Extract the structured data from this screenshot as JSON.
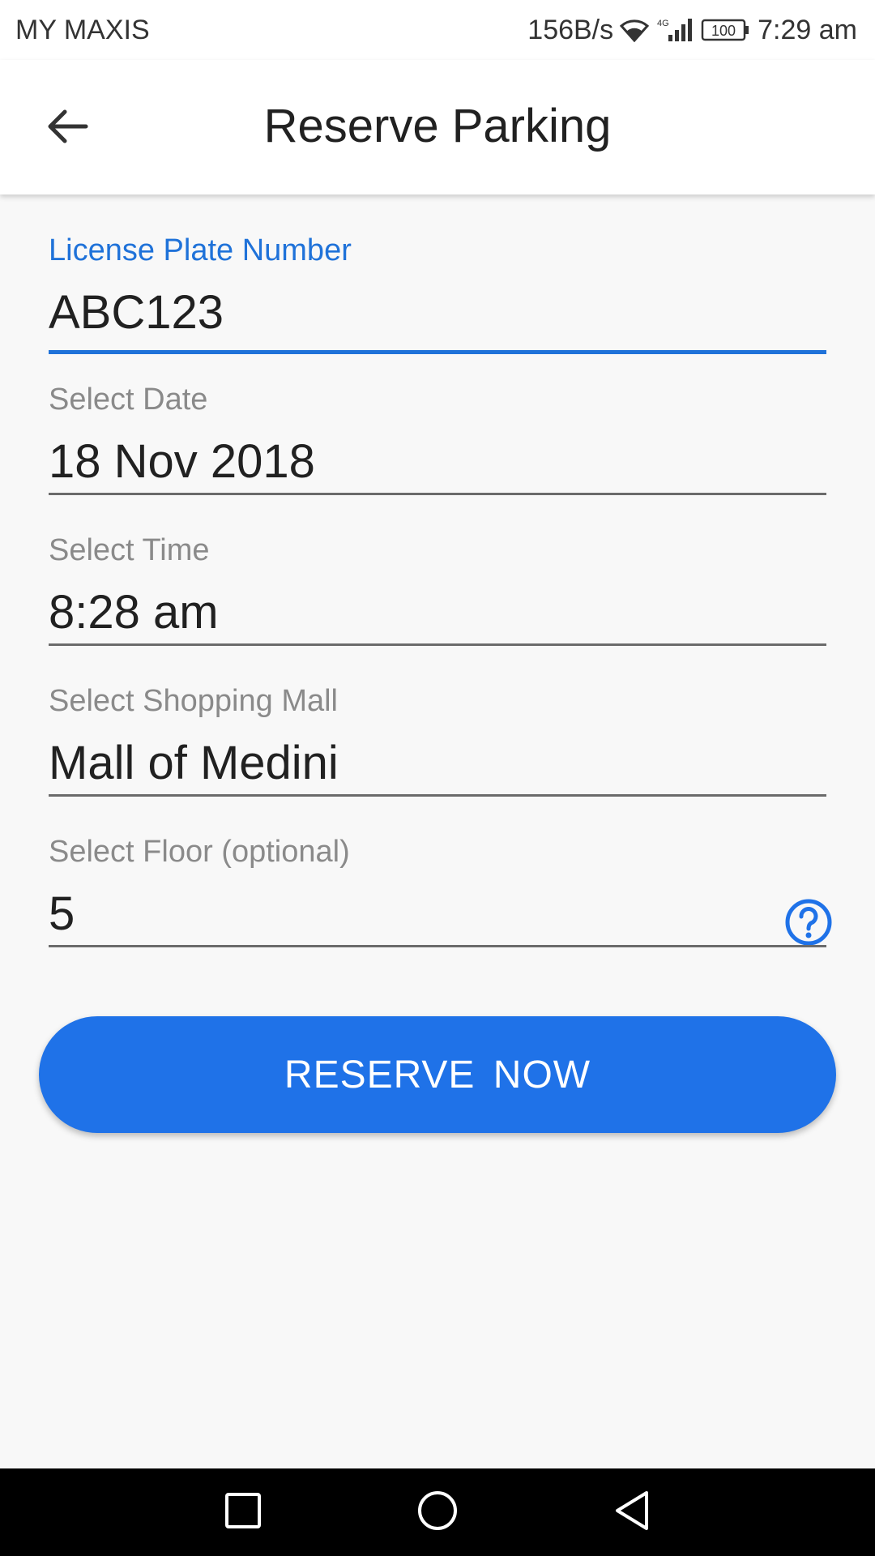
{
  "status_bar": {
    "carrier": "MY MAXIS",
    "network_speed": "156B/s",
    "network_type": "4G",
    "battery": "100",
    "time": "7:29 am",
    "icons": [
      "wifi-icon",
      "signal-icon",
      "battery-icon"
    ]
  },
  "app_bar": {
    "title": "Reserve Parking",
    "back_icon": "arrow-left-icon"
  },
  "form": {
    "license_plate": {
      "label": "License Plate Number",
      "value": "ABC123"
    },
    "date": {
      "label": "Select Date",
      "value": "18 Nov 2018"
    },
    "time": {
      "label": "Select Time",
      "value": "8:28 am"
    },
    "mall": {
      "label": "Select Shopping Mall",
      "value": "Mall of Medini"
    },
    "floor": {
      "label": "Select Floor (optional)",
      "value": "5",
      "help_icon": "help-circle-icon"
    }
  },
  "reserve_button": {
    "label": "RESERVE NOW"
  },
  "nav_bar": {
    "icons": [
      "recent-apps-icon",
      "home-icon",
      "back-icon"
    ]
  },
  "colors": {
    "accent": "#1f72e8",
    "active_label": "#1f72d9",
    "background": "#f8f8f8",
    "nav_bar": "#000000"
  }
}
